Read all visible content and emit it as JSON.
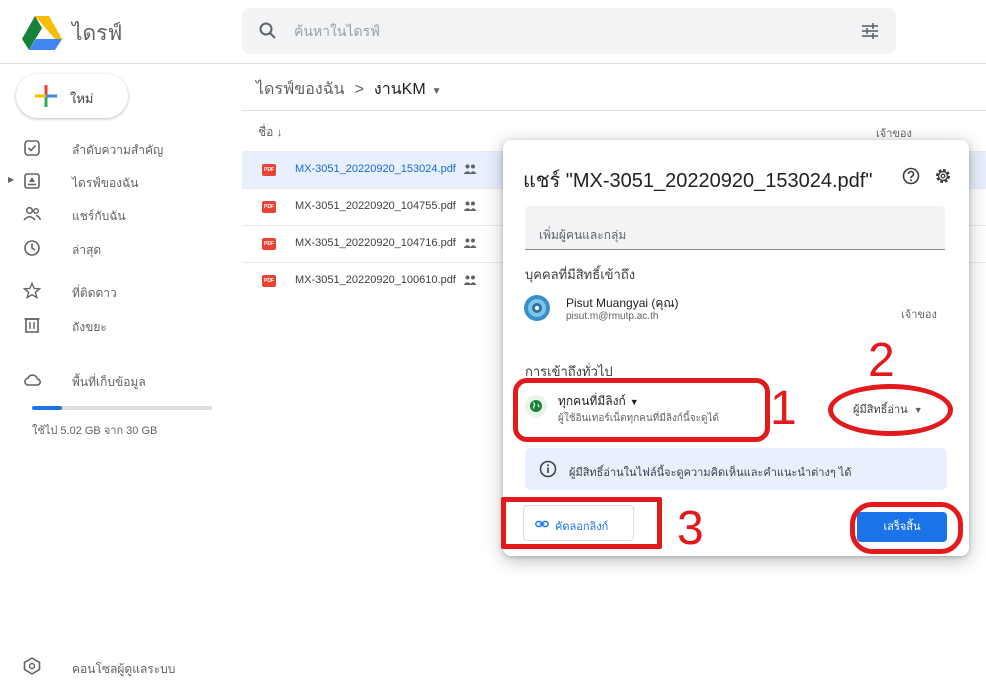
{
  "app": {
    "title": "ไดรฟ์"
  },
  "search": {
    "placeholder": "ค้นหาในไดรฟ์"
  },
  "sidebar": {
    "new_label": "ใหม่",
    "items": [
      {
        "label": "ลำดับความสำคัญ",
        "icon": "priority-icon"
      },
      {
        "label": "ไดรฟ์ของฉัน",
        "icon": "my-drive-icon"
      },
      {
        "label": "แชร์กับฉัน",
        "icon": "shared-with-me-icon"
      },
      {
        "label": "ล่าสุด",
        "icon": "clock-icon"
      },
      {
        "label": "ที่ติดดาว",
        "icon": "star-icon"
      },
      {
        "label": "ถังขยะ",
        "icon": "trash-icon"
      }
    ],
    "storage_label": "พื้นที่เก็บข้อมูล",
    "storage_used_fraction": 0.167,
    "storage_text": "ใช้ไป 5.02 GB จาก 30 GB",
    "admin_label": "คอนโซลผู้ดูแลระบบ"
  },
  "main": {
    "breadcrumb_root": "ไดรฟ์ของฉัน",
    "breadcrumb_sep": ">",
    "breadcrumb_current": "งานKM",
    "col_name": "ชื่อ ↓",
    "col_owner": "เจ้าของ",
    "files": [
      {
        "name": "MX-3051_20220920_153024.pdf",
        "icon_text": "PDF"
      },
      {
        "name": "MX-3051_20220920_104755.pdf",
        "icon_text": "PDF"
      },
      {
        "name": "MX-3051_20220920_104716.pdf",
        "icon_text": "PDF"
      },
      {
        "name": "MX-3051_20220920_100610.pdf",
        "icon_text": "PDF"
      }
    ]
  },
  "dialog": {
    "title": "แชร์ \"MX-3051_20220920_153024.pdf\"",
    "add_placeholder": "เพิ่มผู้คนและกลุ่ม",
    "people_heading": "บุคคลที่มีสิทธิ์เข้าถึง",
    "person_name": "Pisut Muangyai (คุณ)",
    "person_email": "pisut.m@rmutp.ac.th",
    "person_role": "เจ้าของ",
    "general_heading": "การเข้าถึงทั่วไป",
    "access_type": "ทุกคนที่มีลิงก์",
    "access_desc": "ผู้ใช้อินเทอร์เน็ตทุกคนที่มีลิงก์นี้จะดูได้",
    "role": "ผู้มีสิทธิ์อ่าน",
    "info_text": "ผู้มีสิทธิ์อ่านในไฟล์นี้จะดูความคิดเห็นและคำแนะนำต่างๆ ได้",
    "copy_link": "คัดลอกลิงก์",
    "done": "เสร็จสิ้น"
  },
  "annotations": {
    "one": "1",
    "two": "2",
    "three": "3"
  },
  "colors": {
    "accent": "#1a73e8",
    "annotation": "#e3191b",
    "selected_row": "#e8f0fe"
  }
}
